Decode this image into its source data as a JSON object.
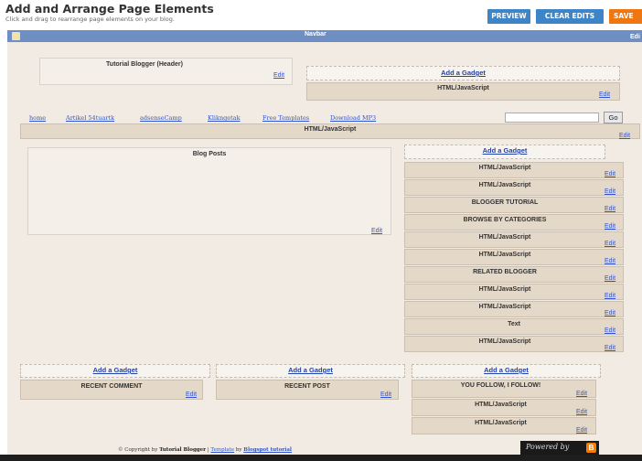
{
  "header": {
    "title": "Add and Arrange Page Elements",
    "subtitle": "Click and drag to rearrange page elements on your blog.",
    "preview_label": "PREVIEW",
    "clear_label": "CLEAR EDITS",
    "save_label": "SAVE"
  },
  "navbar": {
    "label": "Navbar",
    "edit": "Edi"
  },
  "edit_label": "Edit",
  "add_gadget_label": "Add a Gadget",
  "blog_header": {
    "title": "Tutorial Blogger (Header)"
  },
  "header_right": {
    "gadget": "HTML/JavaScript"
  },
  "nav_links": [
    "home",
    "Artikel 54tuartk",
    "adsenseCamp",
    "Klikngetak",
    "Free Templates",
    "Download MP3"
  ],
  "search": {
    "button": "Go",
    "value": ""
  },
  "crossbar": {
    "gadget": "HTML/JavaScript"
  },
  "blog_posts": {
    "title": "Blog Posts"
  },
  "sidebar": {
    "items": [
      "HTML/JavaScript",
      "HTML/JavaScript",
      "BLOGGER TUTORIAL",
      "BROWSE BY CATEGORIES",
      "HTML/JavaScript",
      "HTML/JavaScript",
      "RELATED BLOGGER",
      "HTML/JavaScript",
      "HTML/JavaScript",
      "Text",
      "HTML/JavaScript"
    ]
  },
  "footer_cols": [
    {
      "items": [
        "RECENT COMMENT"
      ]
    },
    {
      "items": [
        "RECENT POST"
      ]
    },
    {
      "items": [
        "YOU FOLLOW, I FOLLOW!",
        "HTML/JavaScript",
        "HTML/JavaScript"
      ]
    }
  ],
  "footer": {
    "copyright_prefix": "© Copyright by",
    "copyright_name": "Tutorial Blogger",
    "template_link": "Template",
    "by": "by",
    "blogspot_link": "Blogspot tutorial",
    "powered_by": "Powered by",
    "blogger_glyph": "B"
  },
  "colors": {
    "accent_blue": "#3d85c6",
    "save_orange": "#ee7711",
    "navbar_blue": "#6f8fc2",
    "canvas_beige": "#f1ebe3",
    "gadget_tan": "#e4d8c8"
  }
}
